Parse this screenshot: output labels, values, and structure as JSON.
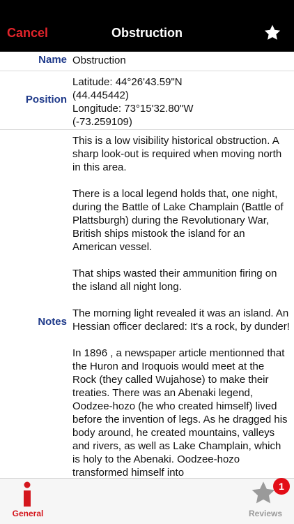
{
  "nav": {
    "cancel_label": "Cancel",
    "title": "Obstruction",
    "favorite_icon": "star-icon"
  },
  "details": {
    "name_label": "Name",
    "name_value": "Obstruction",
    "position_label": "Position",
    "position_lines": [
      "Latitude: 44°26'43.59\"N",
      "(44.445442)",
      "Longitude: 73°15'32.80\"W",
      "(-73.259109)"
    ],
    "notes_label": "Notes",
    "notes_paragraphs": [
      "This is a low visibility historical obstruction. A sharp look-out is required when moving north in this area.",
      "There is a local legend holds that, one night, during the Battle of Lake Champlain (Battle of Plattsburgh) during the Revolutionary War, British ships mistook the island for an American vessel.",
      "That ships wasted their ammunition firing on the island all night long.",
      "The morning light revealed it was an island. An Hessian officer declared: It's a rock, by dunder!",
      "In 1896 , a newspaper article mentionned that the Huron and Iroquois would meet at the Rock (they called Wujahose) to make their treaties.  There was an Abenaki legend, Oodzee-hozo (he who created himself) lived before the invention of legs. As he dragged his body around, he created mountains, valleys and rivers, as well as Lake Champlain, which is holy to the Abenaki. Oodzee-hozo transformed himself into"
    ]
  },
  "tabs": {
    "general_label": "General",
    "reviews_label": "Reviews",
    "reviews_badge": "1"
  },
  "colors": {
    "cancel": "#e3242b",
    "label": "#1f3a8a",
    "tab_active": "#d4161d",
    "badge": "#e30d17"
  }
}
